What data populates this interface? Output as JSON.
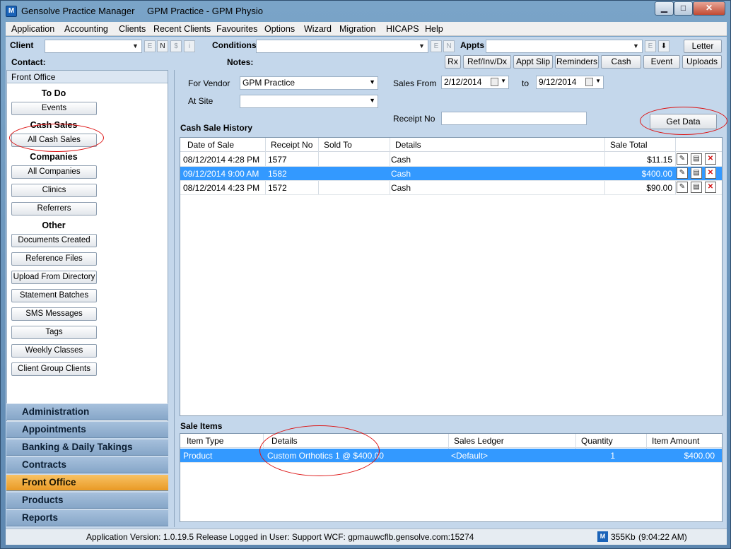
{
  "window": {
    "app_title": "Gensolve Practice Manager",
    "practice_title": "GPM Practice - GPM Physio",
    "icon_letter": "M",
    "min_symbol": "▁",
    "max_symbol": "□",
    "close_symbol": "✕"
  },
  "menu": [
    "Application",
    "Accounting",
    "Clients",
    "Recent Clients",
    "Favourites",
    "Options",
    "Wizard",
    "Migration",
    "HICAPS",
    "Help"
  ],
  "toolbar": {
    "client_label": "Client",
    "conditions_label": "Conditions",
    "appts_label": "Appts",
    "contact_label": "Contact:",
    "notes_label": "Notes:",
    "mini_e": "E",
    "mini_n": "N",
    "mini_s": "$",
    "mini_i": "i",
    "letter_btn": "Letter",
    "down_icon": "⬇",
    "buttons": [
      "Rx",
      "Ref/Inv/Dx",
      "Appt Slip",
      "Reminders",
      "Cash Sale",
      "Event",
      "Uploads"
    ]
  },
  "left_panel": {
    "header": "Front Office",
    "todo_heading": "To Do",
    "events_btn": "Events",
    "cash_sales_heading": "Cash Sales",
    "all_cash_sales_btn": "All Cash Sales",
    "companies_heading": "Companies",
    "all_companies_btn": "All Companies",
    "clinics_btn": "Clinics",
    "referrers_btn": "Referrers",
    "other_heading": "Other",
    "other_buttons": [
      "Documents Created",
      "Reference Files",
      "Upload From Directory",
      "Statement Batches",
      "SMS Messages",
      "Tags",
      "Weekly Classes",
      "Client Group Clients"
    ]
  },
  "nav": [
    "Administration",
    "Appointments",
    "Banking & Daily Takings",
    "Contracts",
    "Front Office",
    "Products",
    "Reports"
  ],
  "filters": {
    "for_vendor_label": "For Vendor",
    "vendor_value": "GPM Practice",
    "at_site_label": "At Site",
    "at_site_value": "",
    "sales_from_label": "Sales From",
    "sales_from_value": "2/12/2014",
    "to_label": "to",
    "to_value": "9/12/2014",
    "receipt_no_label": "Receipt No",
    "receipt_no_value": "",
    "get_data_btn": "Get Data"
  },
  "cash_sale_history": {
    "title": "Cash Sale History",
    "columns": [
      "Date of Sale",
      "Receipt No",
      "Sold To",
      "Details",
      "Sale Total"
    ],
    "rows": [
      {
        "date": "08/12/2014 4:28 PM",
        "receipt": "1577",
        "sold_to": "",
        "details": "Cash",
        "total": "$11.15"
      },
      {
        "date": "09/12/2014 9:00 AM",
        "receipt": "1582",
        "sold_to": "",
        "details": "Cash",
        "total": "$400.00"
      },
      {
        "date": "08/12/2014 4:23 PM",
        "receipt": "1572",
        "sold_to": "",
        "details": "Cash",
        "total": "$90.00"
      }
    ],
    "selected_index": 1
  },
  "sale_items": {
    "title": "Sale Items",
    "columns": [
      "Item Type",
      "Details",
      "Sales Ledger",
      "Quantity",
      "Item Amount"
    ],
    "rows": [
      {
        "type": "Product",
        "details": "Custom Orthotics 1 @ $400.00",
        "ledger": "<Default>",
        "quantity": "1",
        "amount": "$400.00"
      }
    ]
  },
  "status": {
    "version": "Application Version: 1.0.19.5 Release  Logged in User: Support WCF: gpmauwcflb.gensolve.com:15274",
    "memory": "355Kb",
    "time": "(9:04:22 AM)"
  },
  "colors": {
    "accent_selected": "#3399ff",
    "nav_active": "#f0a93a",
    "annotation": "#dd1111"
  }
}
